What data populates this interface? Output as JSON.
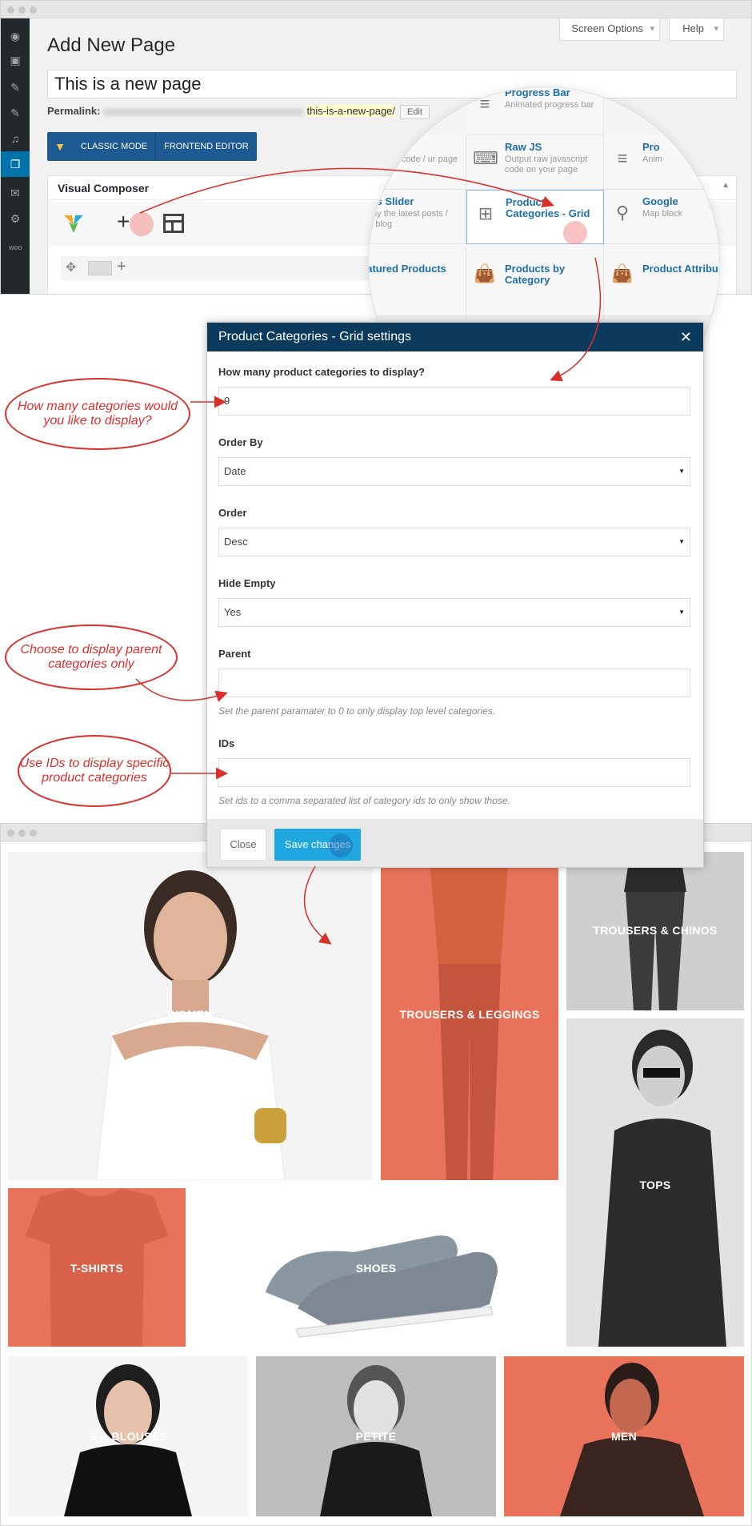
{
  "wp": {
    "page_title": "Add New Page",
    "screen_options": "Screen Options",
    "help": "Help",
    "post_title": "This is a new page",
    "permalink_label": "Permalink:",
    "permalink_slug": "this-is-a-new-page/",
    "edit_btn": "Edit",
    "classic_mode": "CLASSIC MODE",
    "frontend_editor": "FRONTEND EDITOR",
    "vc_title": "Visual Composer",
    "frontend_btn": "tend"
  },
  "elements": [
    {
      "title": "Progress Bar",
      "desc": "Animated progress bar"
    },
    {
      "title": "ML",
      "desc": "t raw html code / ur page"
    },
    {
      "title": "Raw JS",
      "desc": "Output raw javascript code on your page"
    },
    {
      "title": "Pro",
      "desc": "Anim"
    },
    {
      "title": "osts Slider",
      "desc": "splay the latest posts / the blog"
    },
    {
      "title": "Product Categories - Grid",
      "desc": ""
    },
    {
      "title": "Google",
      "desc": "Map block"
    },
    {
      "title": "eatured Products",
      "desc": ""
    },
    {
      "title": "Products by Category",
      "desc": ""
    },
    {
      "title": "Product Attribu",
      "desc": ""
    }
  ],
  "modal": {
    "title": "Product Categories - Grid settings",
    "close_icon": "close-icon",
    "fields": [
      {
        "label": "How many product categories to display?",
        "value": "9"
      },
      {
        "label": "Order By",
        "value": "Date"
      },
      {
        "label": "Order",
        "value": "Desc"
      },
      {
        "label": "Hide Empty",
        "value": "Yes"
      },
      {
        "label": "Parent",
        "value": "",
        "desc": "Set the parent paramater to 0 to only display top level categories."
      },
      {
        "label": "IDs",
        "value": "",
        "desc": "Set ids to a comma separated list of category ids to only show those."
      }
    ],
    "close_btn": "Close",
    "save_btn": "Save changes"
  },
  "annotations": {
    "a1": "How many categories would you like to display?",
    "a2": "Choose to display parent categories only",
    "a3": "Use IDs to display specific product categories"
  },
  "categories": [
    "WOMEN",
    "TROUSERS & LEGGINGS",
    "TROUSERS & CHINOS",
    "TOPS",
    "T-SHIRTS",
    "SHOES",
    "S & BLOUSES",
    "PETITE",
    "MEN"
  ],
  "colors": {
    "accent": "#e8735a",
    "wp_blue": "#0073aa",
    "modal_head": "#0b3a5c",
    "save": "#1fa8e0",
    "annotation": "#d9302c"
  }
}
